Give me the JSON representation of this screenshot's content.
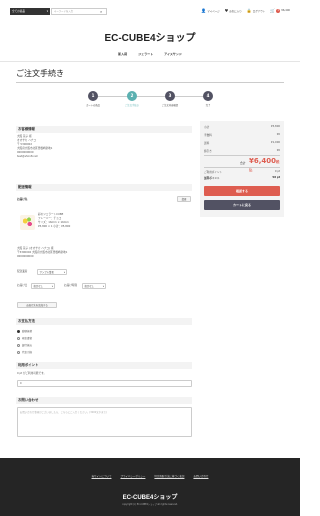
{
  "header": {
    "category_select": "全ての商品",
    "search_placeholder": "キーワードを入力",
    "nav": {
      "mypage": "マイページ",
      "favorite": "お気に入り",
      "logout": "ログアウト",
      "cart_count": "1",
      "cart_total": "¥6,400"
    }
  },
  "shop_name": "EC-CUBE4ショップ",
  "global_nav": [
    "新入荷",
    "ジェラート",
    "アイスサンド"
  ],
  "page_title": "ご注文手続き",
  "flow_steps": [
    {
      "num": "1",
      "label": "カートの商品",
      "active": false
    },
    {
      "num": "2",
      "label": "ご注文手続き",
      "active": true
    },
    {
      "num": "3",
      "label": "ご注文内容確認",
      "active": false
    },
    {
      "num": "4",
      "label": "完了",
      "active": false
    }
  ],
  "customer": {
    "heading": "お客様情報",
    "name": "大阪 花子 様",
    "kana": "オオサカ ハナコ",
    "zip": "〒 5300002",
    "address": "大阪府大阪市北区曽根崎新地1",
    "phone": "0000000000",
    "email": "test@shiro8.net"
  },
  "shipping": {
    "heading": "配送情報",
    "destination_label": "お届け先",
    "change_button": "変更",
    "product_name": "彩のジェラートCUBE",
    "product_variant": "フレーバー：チョコ",
    "product_size": "サイズ：16mm × 16mm",
    "product_price": "¥5,800 × 1 小計：¥5,800",
    "dest_name": "大阪 花子 (オオサカ ハナコ) 様",
    "dest_address": "〒5300002 大阪府大阪市北区曽根崎新地1",
    "dest_phone": "0000000000",
    "delivery_label": "配送業者",
    "delivery_value": "サンプル業者",
    "date_label": "お届け日",
    "date_value": "指定なし",
    "time_label": "お届け時間",
    "time_value": "指定なし",
    "add_destination_button": "お届け先を追加する"
  },
  "payment": {
    "heading": "お支払方法",
    "options": [
      {
        "label": "郵便振替",
        "checked": true
      },
      {
        "label": "現金書留",
        "checked": false
      },
      {
        "label": "銀行振込",
        "checked": false
      },
      {
        "label": "代金引換",
        "checked": false
      }
    ]
  },
  "points": {
    "heading": "利用ポイント",
    "note": "0 pt がご利用可能です。",
    "value": "0"
  },
  "inquiry": {
    "heading": "お問い合わせ",
    "placeholder": "お問い合わせ事項がございましたら、こちらにご入力ください。(3000文字まで)"
  },
  "summary": {
    "subtotal_label": "小計",
    "subtotal": "¥5,800",
    "fee_label": "手数料",
    "fee": "¥0",
    "shipping_label": "送料",
    "shipping": "¥1,000",
    "discount_label": "値引き",
    "discount": "¥0",
    "total_label": "合計",
    "total": "¥6,400",
    "total_suffix": "税込",
    "points_label": "ご利用ポイント",
    "points": "0 pt",
    "earned_label": "加算ポイント",
    "earned": "58 pt",
    "confirm_button": "確認する",
    "back_button": "カートに戻る"
  },
  "footer": {
    "links": [
      "当サイトについて",
      "プライバシーポリシー",
      "特定商取引法に基づく表記",
      "お問い合わせ"
    ],
    "logo": "EC-CUBE4ショップ",
    "copyright": "copyright (c) EC-CUBE4ショップ all rights reserved."
  }
}
